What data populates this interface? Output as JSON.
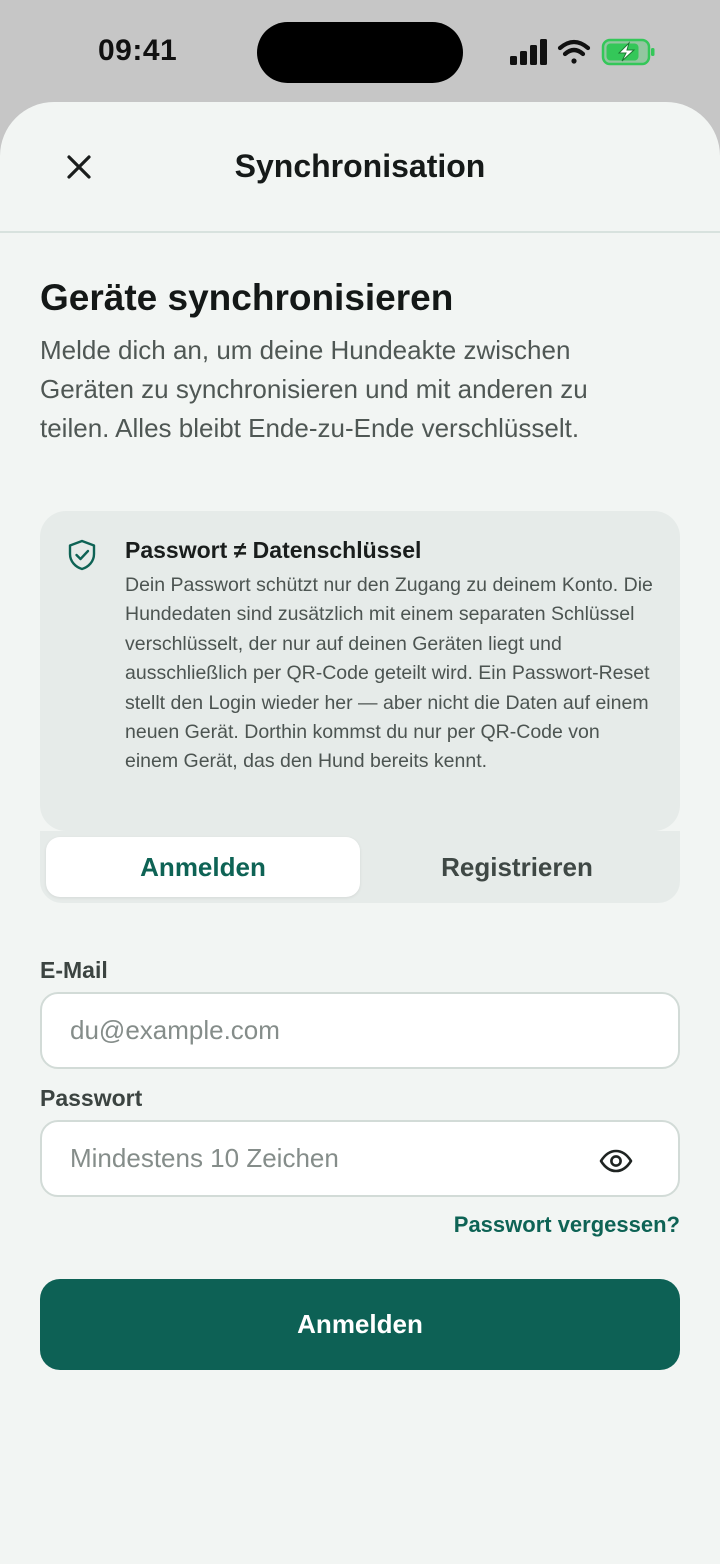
{
  "status_bar": {
    "time": "09:41",
    "icons": [
      "cellular-signal-icon",
      "wifi-icon",
      "battery-charging-icon"
    ]
  },
  "header": {
    "title": "Synchronisation",
    "close_icon": "close-icon"
  },
  "main": {
    "headline": "Geräte synchronisieren",
    "intro": "Melde dich an, um deine Hundeakte zwischen Geräten zu synchronisieren und mit anderen zu teilen. Alles bleibt Ende-zu-Ende verschlüsselt."
  },
  "info_card": {
    "icon": "shield-check-icon",
    "title": "Passwort ≠ Datenschlüssel",
    "body": "Dein Passwort schützt nur den Zugang zu deinem Konto. Die Hundedaten sind zusätzlich mit einem separaten Schlüssel verschlüsselt, der nur auf deinen Geräten liegt und ausschließlich per QR-Code geteilt wird. Ein Passwort-Reset stellt den Login wieder her — aber nicht die Daten auf einem neuen Gerät. Dorthin kommst du nur per QR-Code von einem Gerät, das den Hund bereits kennt."
  },
  "tabs": {
    "active": "Anmelden",
    "items": [
      {
        "label": "Anmelden"
      },
      {
        "label": "Registrieren"
      }
    ]
  },
  "form": {
    "email_label": "E-Mail",
    "email_placeholder": "du@example.com",
    "email_value": "",
    "password_label": "Passwort",
    "password_placeholder": "Mindestens 10 Zeichen",
    "password_value": "",
    "forgot_label": "Passwort vergessen?",
    "submit_label": "Anmelden"
  },
  "colors": {
    "accent": "#0d6155",
    "sheet_background": "#f2f5f3",
    "card_background": "#e6ebe9",
    "battery_green": "#34c759"
  }
}
